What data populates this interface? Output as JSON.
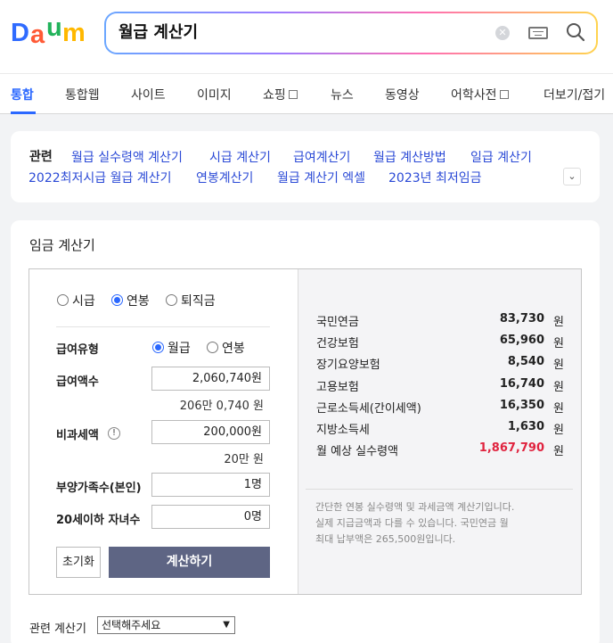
{
  "logo": {
    "letters": [
      "D",
      "a",
      "u",
      "m"
    ],
    "colors": [
      "#2f6bff",
      "#ff5a36",
      "#22b35b",
      "#ffb800"
    ]
  },
  "search": {
    "value": "월급 계산기",
    "clear_symbol": "✕"
  },
  "tabs": [
    {
      "label": "통합",
      "active": true
    },
    {
      "label": "통합웹"
    },
    {
      "label": "사이트"
    },
    {
      "label": "이미지"
    },
    {
      "label": "쇼핑",
      "has_box": true
    },
    {
      "label": "뉴스"
    },
    {
      "label": "동영상"
    },
    {
      "label": "어학사전",
      "has_box": true
    },
    {
      "label": "더보기/접기"
    }
  ],
  "related": {
    "title": "관련",
    "links": [
      "월급 실수령액 계산기",
      "시급 계산기",
      "급여계산기",
      "월급 계산방법",
      "일급 계산기",
      "2022최저시급 월급 계산기",
      "연봉계산기",
      "월급 계산기 엑셀",
      "2023년 최저임금"
    ]
  },
  "calculator": {
    "title": "임금 계산기",
    "mode_options": [
      {
        "label": "시급",
        "selected": false
      },
      {
        "label": "연봉",
        "selected": true
      },
      {
        "label": "퇴직금",
        "selected": false
      }
    ],
    "pay_type": {
      "label": "급여유형",
      "options": [
        {
          "label": "월급",
          "selected": true
        },
        {
          "label": "연봉",
          "selected": false
        }
      ]
    },
    "salary": {
      "label": "급여액수",
      "value": "2,060,740원",
      "sub": "206만 0,740 원"
    },
    "nontax": {
      "label": "비과세액",
      "info": "!",
      "value": "200,000원",
      "sub": "20만 원"
    },
    "dependents": {
      "label": "부양가족수(본인)",
      "value": "1명"
    },
    "children": {
      "label": "20세이하 자녀수",
      "value": "0명"
    },
    "reset_label": "초기화",
    "calc_label": "계산하기"
  },
  "results": {
    "unit": "원",
    "rows": [
      {
        "name": "국민연금",
        "value": "83,730"
      },
      {
        "name": "건강보험",
        "value": "65,960"
      },
      {
        "name": "장기요양보험",
        "value": "8,540"
      },
      {
        "name": "고용보험",
        "value": "16,740"
      },
      {
        "name": "근로소득세(간이세액)",
        "value": "16,350"
      },
      {
        "name": "지방소득세",
        "value": "1,630"
      },
      {
        "name": "월 예상 실수령액",
        "value": "1,867,790",
        "highlight": true
      }
    ],
    "note_lines": [
      "간단한 연봉 실수령액 및 과세금액 계산기입니다.",
      "실제 지급금액과 다를 수 있습니다. 국민연금 월",
      "최대 납부액은 265,500원입니다."
    ]
  },
  "related_calc": {
    "label": "관련 계산기",
    "select_value": "선택해주세요"
  }
}
